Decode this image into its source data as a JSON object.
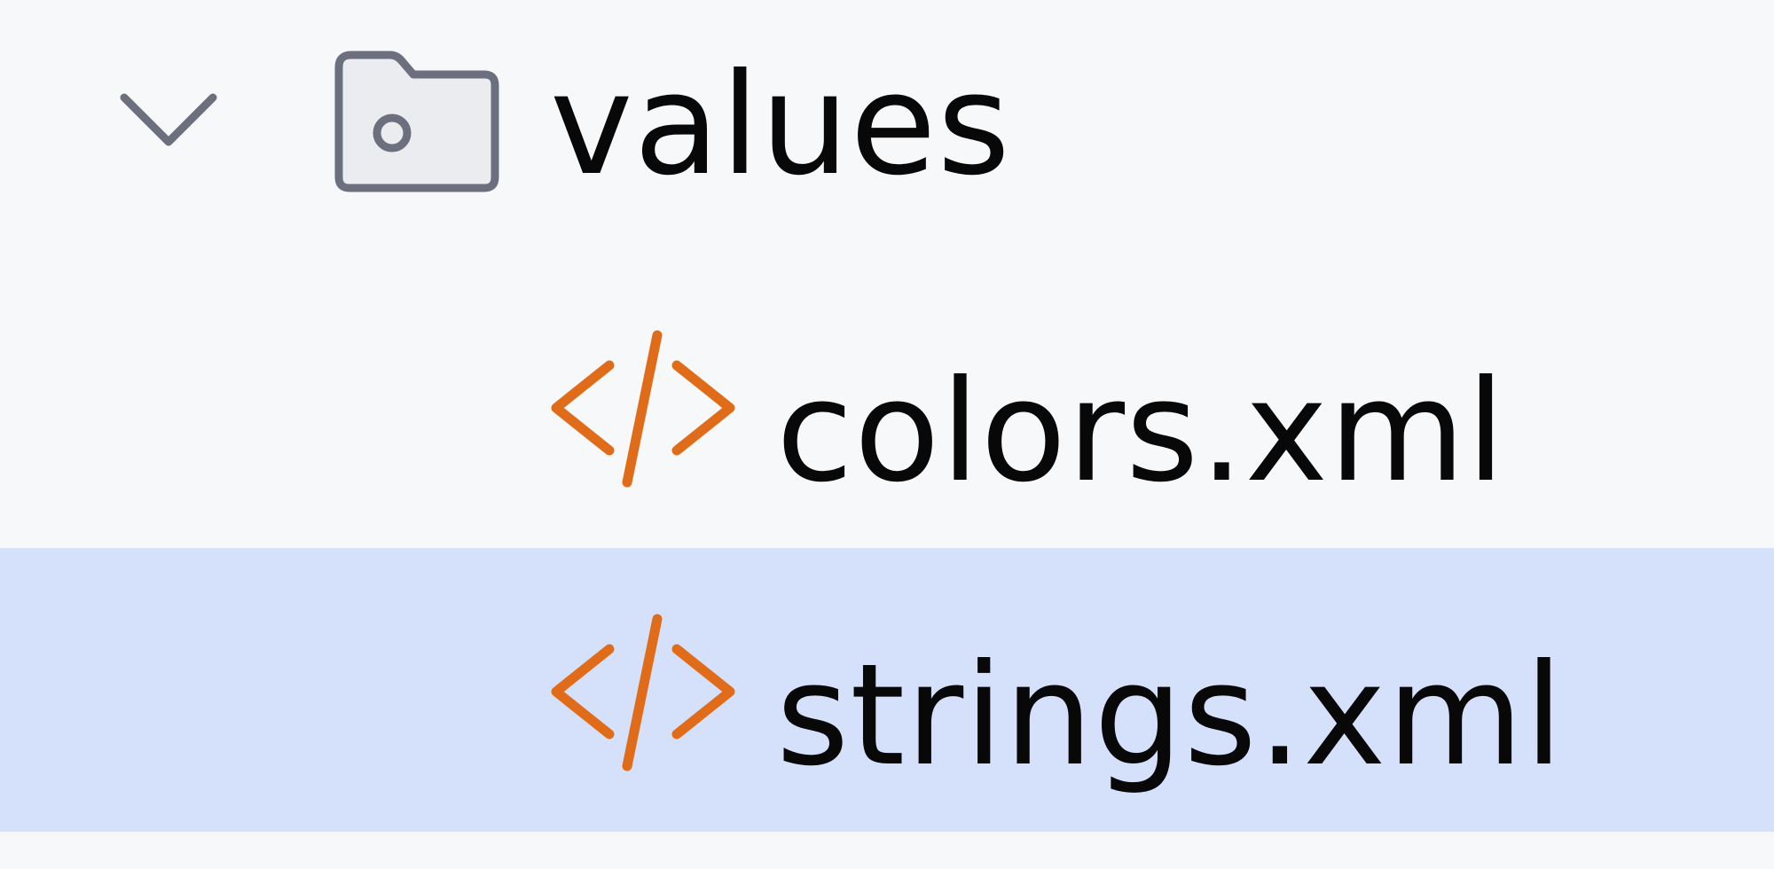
{
  "project_tree": {
    "items": [
      {
        "label": "values",
        "type": "folder",
        "icon": "folder-icon",
        "expanded": true,
        "expander_icon": "chevron-down-icon",
        "selected": false
      },
      {
        "label": "colors.xml",
        "type": "file",
        "icon": "xml-file-icon",
        "selected": false
      },
      {
        "label": "strings.xml",
        "type": "file",
        "icon": "xml-file-icon",
        "selected": true
      }
    ]
  },
  "colors": {
    "background": "#f7f8fa",
    "selection": "#d5e1fb",
    "xml_icon": "#e06c1a",
    "folder_icon_stroke": "#6c707e",
    "folder_icon_fill": "#ebecf0",
    "text": "#080808"
  }
}
